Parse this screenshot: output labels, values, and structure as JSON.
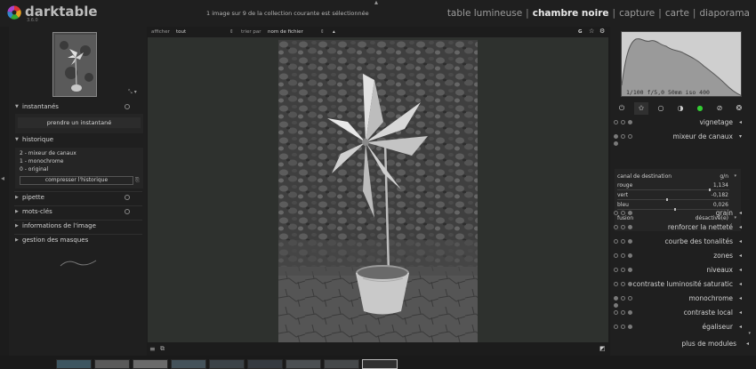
{
  "header": {
    "app_name": "darktable",
    "version": "3.6.0",
    "collection_info": "1 image sur 9 de la collection courante est sélectionnée",
    "views": [
      "table lumineuse",
      "chambre noire",
      "capture",
      "carte",
      "diaporama"
    ],
    "active_view": "chambre noire"
  },
  "left": {
    "navigation_zoom": "⤡ ▾",
    "sections": {
      "snapshots": "instantanés",
      "history": "historique",
      "picker": "pipette",
      "tags": "mots-clés",
      "image_info": "informations de l'image",
      "masks": "gestion des masques"
    },
    "snapshot_button": "prendre un instantané",
    "history_items": [
      "2 - mixeur de canaux",
      "1 - monochrome",
      "0 - original"
    ],
    "compress_button": "compresser l'historique"
  },
  "center_toolbar": {
    "show_label": "afficher",
    "show_value": "tout",
    "sort_label": "trier par",
    "sort_value": "nom de fichier",
    "sort_dir": "▴",
    "g_label": "G",
    "star_icon": "☆",
    "gear_icon": "⚙"
  },
  "histogram": {
    "info": "1/100 f/5,0 50mm iso 400"
  },
  "modules": [
    {
      "name": "vignetage",
      "arrow": "◂"
    },
    {
      "name": "mixeur de canaux",
      "arrow": "▾"
    },
    {
      "name": "grain",
      "arrow": "◂"
    },
    {
      "name": "renforcer la netteté",
      "arrow": "◂"
    },
    {
      "name": "courbe des tonalités",
      "arrow": "◂"
    },
    {
      "name": "zones",
      "arrow": "◂"
    },
    {
      "name": "niveaux",
      "arrow": "◂"
    },
    {
      "name": "contraste luminosité saturatic",
      "arrow": "◂"
    },
    {
      "name": "monochrome",
      "arrow": "◂"
    },
    {
      "name": "contraste local",
      "arrow": "◂"
    },
    {
      "name": "égaliseur",
      "arrow": "◂"
    }
  ],
  "mixer": {
    "dest_label": "canal de destination",
    "dest_value": "g/n",
    "red_label": "rouge",
    "red_value": "1,134",
    "red_level": 0.82,
    "green_label": "vert",
    "green_value": "-0,182",
    "green_level": 0.44,
    "blue_label": "bleu",
    "blue_value": "0,026",
    "blue_level": 0.51,
    "blend_label": "fusion",
    "blend_value": "désactivé(e)"
  },
  "more_modules": "plus de modules"
}
